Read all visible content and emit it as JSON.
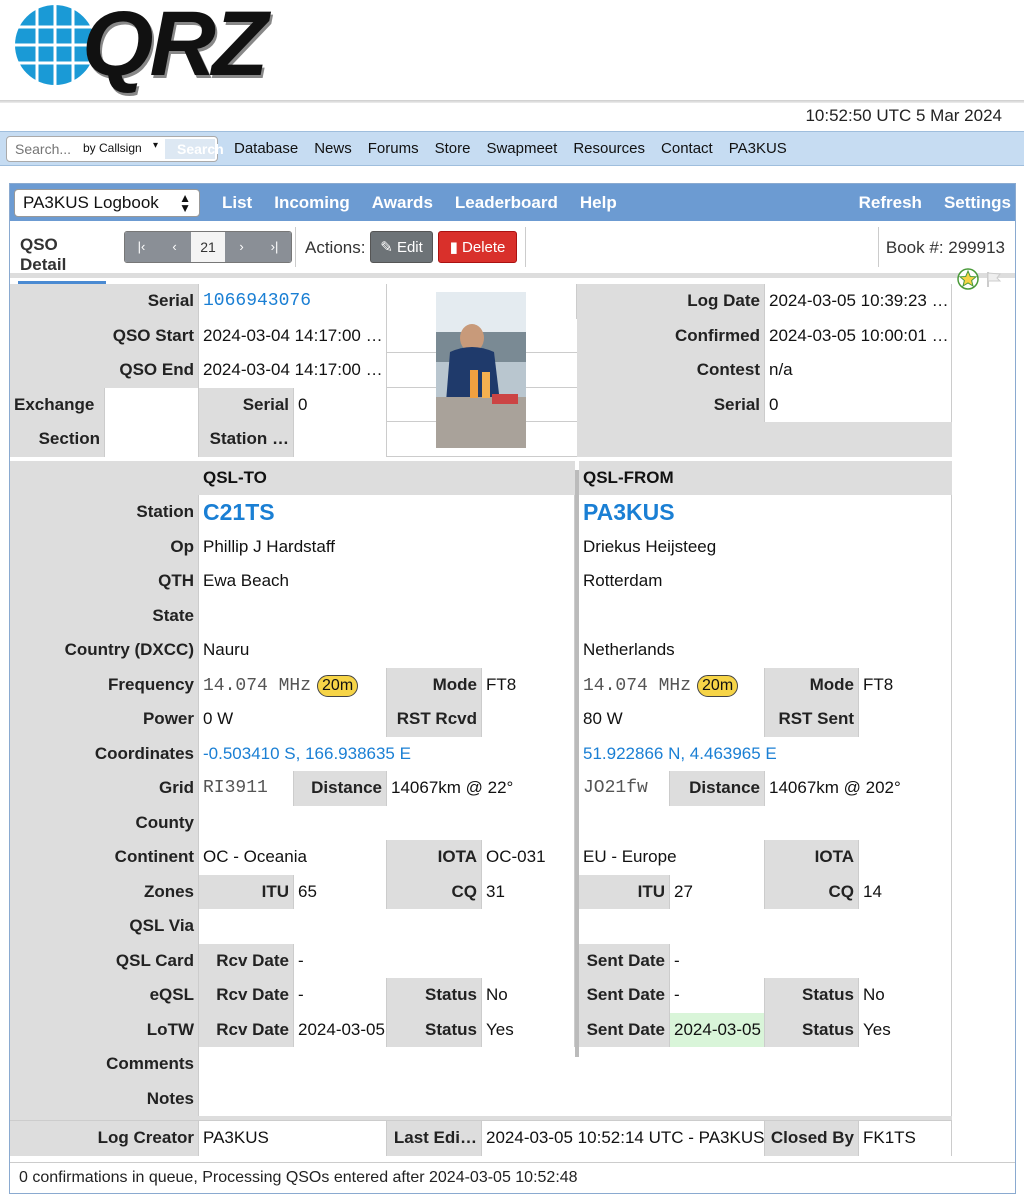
{
  "header": {
    "logo_text": "QRZ",
    "utc_time": "10:52:50 UTC 5 Mar 2024"
  },
  "nav": {
    "search_placeholder": "Search...",
    "search_by": "by Callsign",
    "search_button": "Search",
    "links": [
      "Database",
      "News",
      "Forums",
      "Store",
      "Swapmeet",
      "Resources",
      "Contact",
      "PA3KUS"
    ]
  },
  "logbook": {
    "selector": "PA3KUS Logbook",
    "menu": [
      "List",
      "Incoming",
      "Awards",
      "Leaderboard",
      "Help"
    ],
    "menu_right": [
      "Refresh",
      "Settings"
    ],
    "tab": "QSO Detail",
    "page": "21",
    "actions_label": "Actions:",
    "edit_label": "Edit",
    "delete_label": "Delete",
    "book": "Book #: 299913"
  },
  "detail": {
    "serial_label": "Serial",
    "serial": "1066943076",
    "qso_start_label": "QSO Start",
    "qso_start": "2024-03-04 14:17:00 …",
    "qso_end_label": "QSO End",
    "qso_end": "2024-03-04 14:17:00 …",
    "exchange_label": "Exchange",
    "exchange": "",
    "exch_serial_label": "Serial",
    "exch_serial": "0",
    "section_label": "Section",
    "section": "",
    "station_label_short": "Station …",
    "station_short": "",
    "log_date_label": "Log Date",
    "log_date": "2024-03-05 10:39:23 …",
    "confirmed_label": "Confirmed",
    "confirmed": "2024-03-05 10:00:01 …",
    "contest_label": "Contest",
    "contest": "n/a",
    "r_serial_label": "Serial",
    "r_serial": "0"
  },
  "qsl": {
    "to_header": "QSL-TO",
    "from_header": "QSL-FROM",
    "labels": {
      "station": "Station",
      "op": "Op",
      "qth": "QTH",
      "state": "State",
      "country": "Country (DXCC)",
      "frequency": "Frequency",
      "mode": "Mode",
      "power": "Power",
      "rst_rcvd": "RST Rcvd",
      "rst_sent": "RST Sent",
      "coordinates": "Coordinates",
      "grid": "Grid",
      "distance": "Distance",
      "county": "County",
      "continent": "Continent",
      "iota": "IOTA",
      "zones": "Zones",
      "itu": "ITU",
      "cq": "CQ",
      "qsl_via": "QSL Via",
      "qsl_card": "QSL Card",
      "rcv_date": "Rcv Date",
      "sent_date": "Sent Date",
      "eqsl": "eQSL",
      "lotw": "LoTW",
      "status": "Status",
      "comments": "Comments",
      "notes": "Notes",
      "log_creator": "Log Creator",
      "last_edit": "Last Edi…",
      "closed_by": "Closed By"
    },
    "to": {
      "station": "C21TS",
      "op": "Phillip J Hardstaff",
      "qth": "Ewa Beach",
      "state": "",
      "country": "Nauru",
      "frequency": "14.074 MHz",
      "band": "20m",
      "mode": "FT8",
      "power": "0 W",
      "rst_rcvd": "",
      "coordinates": "-0.503410 S, 166.938635 E",
      "grid": "RI3911",
      "distance": "14067km @ 22°",
      "county": "",
      "continent": "OC - Oceania",
      "iota": "OC-031",
      "itu": "65",
      "cq": "31",
      "qsl_via": "",
      "qsl_rcv": "-",
      "eqsl_rcv": "-",
      "eqsl_status": "No",
      "lotw_rcv": "2024-03-05",
      "lotw_status": "Yes"
    },
    "from": {
      "station": "PA3KUS",
      "op": "Driekus Heijsteeg",
      "qth": "Rotterdam",
      "state": "",
      "country": "Netherlands",
      "frequency": "14.074 MHz",
      "band": "20m",
      "mode": "FT8",
      "power": "80 W",
      "rst_sent": "",
      "coordinates": "51.922866 N, 4.463965 E",
      "grid": "JO21fw",
      "distance": "14067km @ 202°",
      "county": "",
      "continent": "EU - Europe",
      "iota": "",
      "itu": "27",
      "cq": "14",
      "qsl_via": "",
      "qsl_sent": "-",
      "eqsl_sent": "-",
      "eqsl_status": "No",
      "lotw_sent": "2024-03-05",
      "lotw_status": "Yes"
    },
    "comments": "",
    "notes": "",
    "log_creator": "PA3KUS",
    "last_edit": "2024-03-05 10:52:14 UTC - PA3KUS",
    "closed_by": "FK1TS"
  },
  "footer": "0 confirmations in queue, Processing QSOs entered after 2024-03-05 10:52:48",
  "colors": {
    "nav_bg": "#c6dcf2",
    "logbar": "#6c9bd2",
    "link": "#1a7fd4",
    "band": "#f6d447",
    "delete": "#d9302b"
  }
}
